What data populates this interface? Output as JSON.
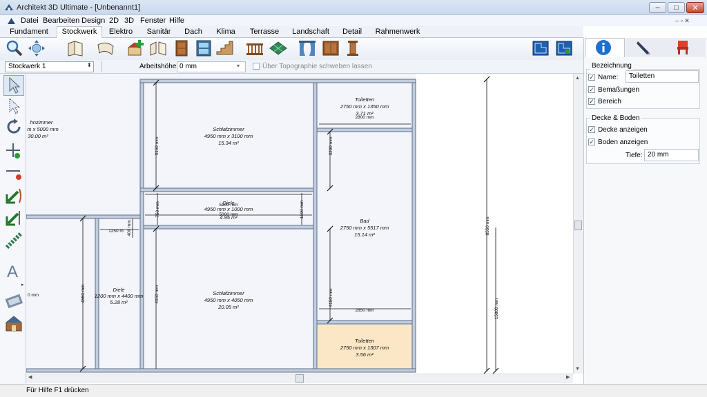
{
  "window": {
    "title": "Architekt 3D Ultimate - [Unbenannt1]",
    "controls": {
      "minimize": "–",
      "maximize": "□",
      "close": "✕"
    }
  },
  "menu": {
    "items": [
      "Datei",
      "Bearbeiten",
      "Design",
      "2D",
      "3D",
      "Fenster",
      "Hilfe"
    ]
  },
  "tabs": {
    "items": [
      "Fundament",
      "Stockwerk",
      "Elektro",
      "Sanitär",
      "Dach",
      "Klima",
      "Terrasse",
      "Landschaft",
      "Detail",
      "Rahmenwerk"
    ],
    "active": "Stockwerk"
  },
  "toolbar": {
    "icons": [
      "zoom-icon",
      "pan-icon",
      "wall-book-icon",
      "curved-wall-icon",
      "house-add-icon",
      "wall-open-icon",
      "door-icon",
      "window-icon",
      "stairs-icon",
      "railing-icon",
      "floor-tile-icon",
      "curtain-icon",
      "cabinet-icon",
      "column-icon",
      "floorplan-view-icon",
      "floorplan-3d-icon"
    ]
  },
  "options": {
    "floor_value": "Stockwerk 1",
    "wall_height_label": "Arbeitshöhe:",
    "wall_height_value": "0 mm",
    "topo_label": "Über Topographie schweben lassen"
  },
  "right_panel": {
    "tabs": [
      "info-icon",
      "pen-icon",
      "chair-icon"
    ],
    "bezeichnung": {
      "title": "Bezeichnung",
      "name_label": "Name:",
      "name_value": "Toiletten",
      "bemassungen_label": "Bemaßungen",
      "bereich_label": "Bereich"
    },
    "decke": {
      "title": "Decke & Boden",
      "decke_label": "Decke anzeigen",
      "boden_label": "Boden anzeigen",
      "tiefe_label": "Tiefe:",
      "tiefe_value": "20 mm"
    }
  },
  "floorplan": {
    "rooms": [
      {
        "name": "hnzimmer",
        "dims": "m x 5000 mm",
        "area": "30.00 m²"
      },
      {
        "name": "Schlafzimmer",
        "dims": "4950 mm x 3100 mm",
        "area": "15.34 m²"
      },
      {
        "name": "Toiletten",
        "dims": "2750 mm x 1350 mm",
        "area": "3.71 m²"
      },
      {
        "name": "Diele",
        "dims": "4950 mm x 1000 mm",
        "area": "4.95 m²"
      },
      {
        "name": "Bad",
        "dims": "2750 mm x 5517 mm",
        "area": "15.14 m²"
      },
      {
        "name": "Diele",
        "dims": "1200 mm x 4400 mm",
        "area": "5.28 m²"
      },
      {
        "name": "Schlafzimmer",
        "dims": "4950 mm x 4050 mm",
        "area": "20.05 m²"
      },
      {
        "name": "Toiletten",
        "dims": "2750 mm x 1307 mm",
        "area": "3.56 m²"
      }
    ],
    "dimensions": {
      "d2800": "2800 mm",
      "d3150": "3150 mm",
      "d3200": "3200 mm",
      "d5100": "5100 mm",
      "d5000": "5000 mm",
      "d750": "750 mm",
      "d1100": "1100 mm",
      "d1250": "1250 m",
      "d400": "400 mm",
      "d4550": "4550 mm",
      "d4150a": "4150 mm",
      "d4150b": "4150 mm",
      "d2850": "2850 mm",
      "d8550": "8550 mm",
      "d15800": "15800 mm",
      "d0mm": "0 mm"
    },
    "highlight_color": "#fbe7c6",
    "wall_color": "#8f9fb7"
  },
  "status": {
    "text": "Für Hilfe F1 drücken"
  }
}
